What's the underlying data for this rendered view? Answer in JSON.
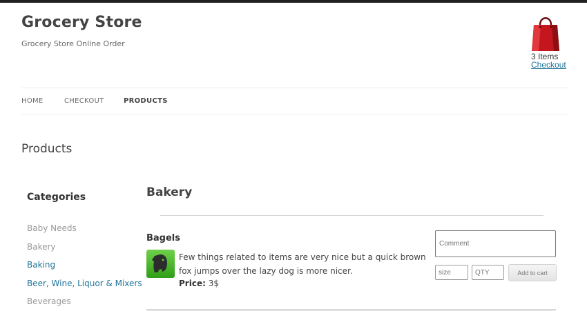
{
  "site": {
    "title": "Grocery Store",
    "description": "Grocery Store Online Order"
  },
  "cart": {
    "count_text": "3 Items",
    "checkout_label": "Checkout",
    "icon": "shopping-bag-icon",
    "icon_color": "#c4161c"
  },
  "nav": {
    "items": [
      {
        "label": "HOME"
      },
      {
        "label": "CHECKOUT"
      },
      {
        "label": "PRODUCTS"
      }
    ],
    "active": "PRODUCTS"
  },
  "page": {
    "title": "Products"
  },
  "categories": {
    "title": "Categories",
    "items": [
      {
        "label": "Baby Needs"
      },
      {
        "label": "Bakery"
      },
      {
        "label": "Baking"
      },
      {
        "label": "Beer, Wine, Liquor & Mixers"
      },
      {
        "label": "Beverages"
      }
    ]
  },
  "section": {
    "title": "Bakery"
  },
  "product": {
    "name": "Bagels",
    "icon": "evernote-elephant-icon",
    "description": "Few things related to items are very nice but a quick brown fox jumps over the lazy dog is more nicer.",
    "price_label": "Price:",
    "price_value": "3$",
    "comment_placeholder": "Comment",
    "size_placeholder": "size",
    "qty_placeholder": "QTY",
    "add_label": "Add to cart"
  },
  "colors": {
    "link": "#21759b",
    "accent_green": "#3fb025"
  }
}
